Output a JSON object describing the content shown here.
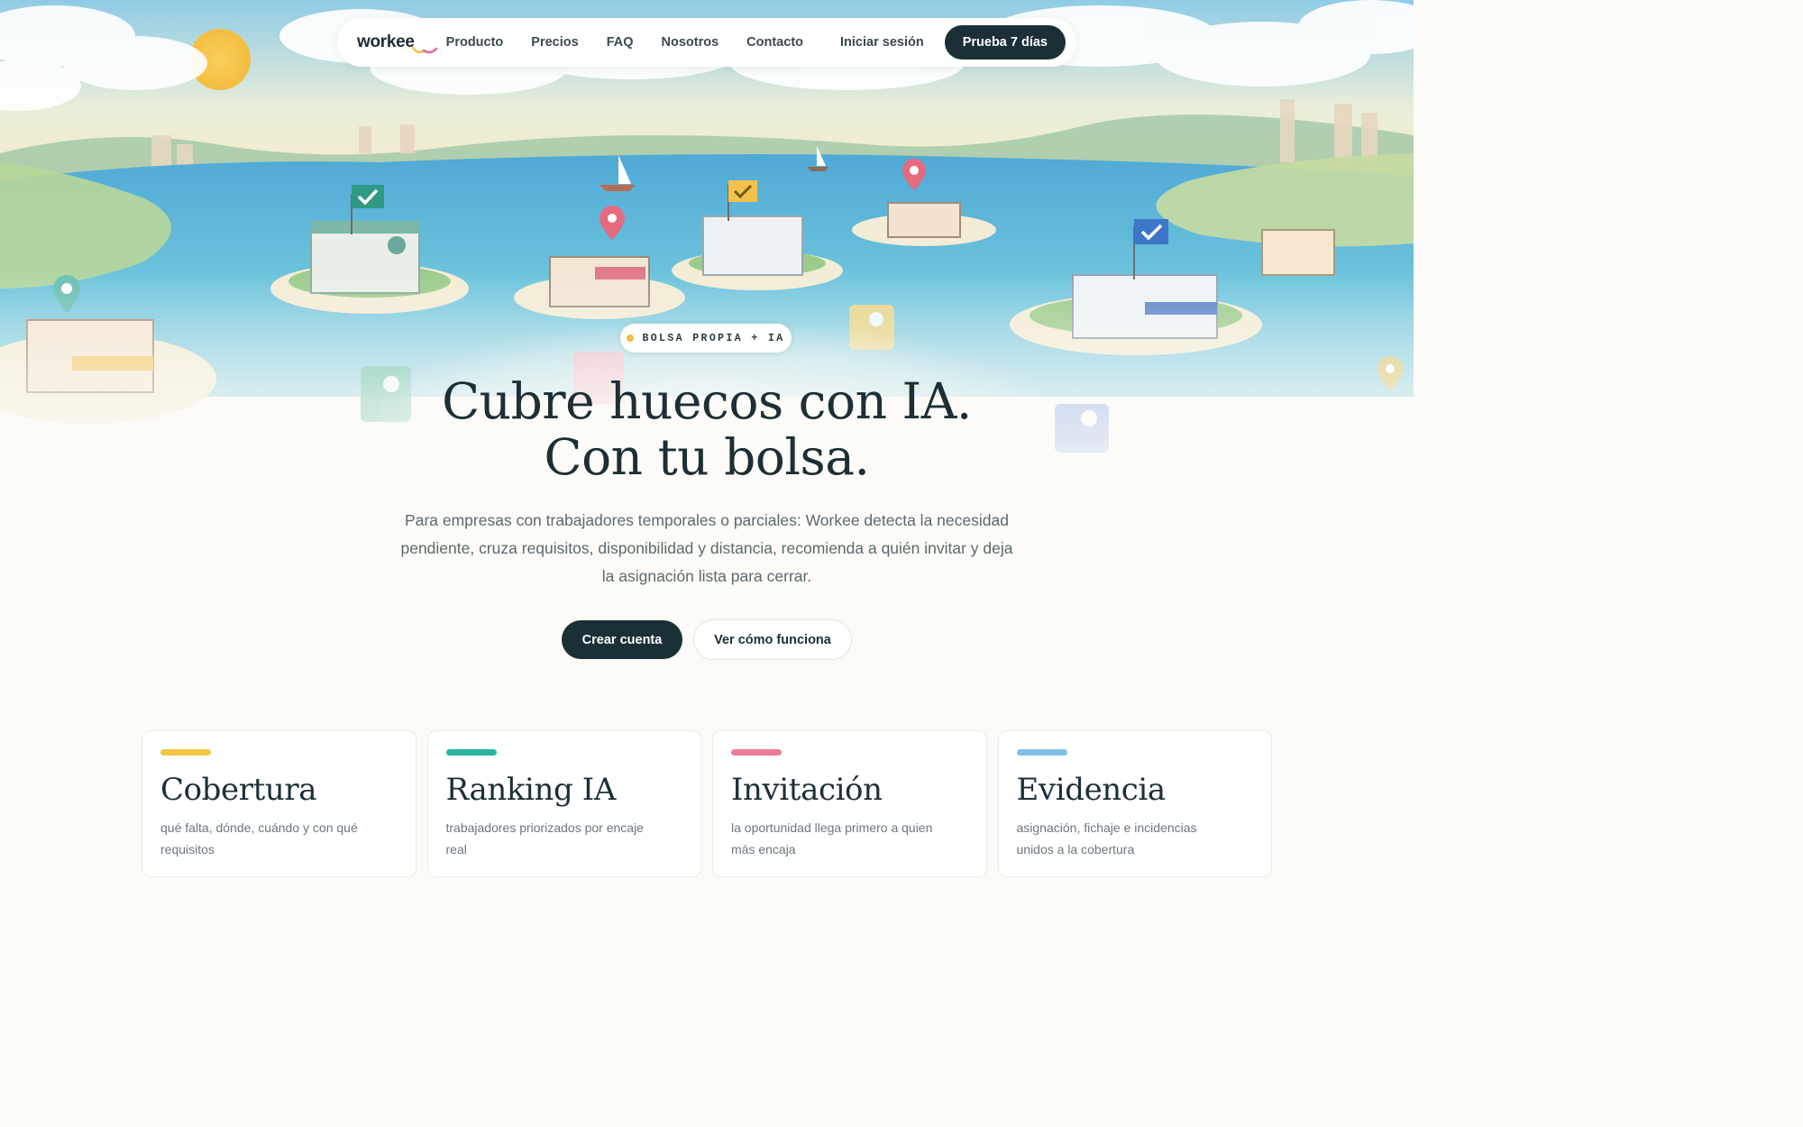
{
  "nav": {
    "logo": "workee",
    "links": [
      "Producto",
      "Precios",
      "FAQ",
      "Nosotros",
      "Contacto"
    ],
    "login": "Iniciar sesión",
    "cta": "Prueba 7 días"
  },
  "hero": {
    "badge": "BOLSA PROPIA + IA",
    "headline_line1": "Cubre huecos con IA.",
    "headline_line2": "Con tu bolsa.",
    "subtitle": "Para empresas con trabajadores temporales o parciales: Workee detecta la necesidad pendiente, cruza requisitos, disponibilidad y distancia, recomienda a quién invitar y deja la asignación lista para cerrar.",
    "primary_button": "Crear cuenta",
    "secondary_button": "Ver cómo funciona"
  },
  "features": [
    {
      "title": "Cobertura",
      "description": "qué falta, dónde, cuándo y con qué requisitos",
      "color": "#f2c646"
    },
    {
      "title": "Ranking IA",
      "description": "trabajadores priorizados por encaje real",
      "color": "#2bb3a2"
    },
    {
      "title": "Invitación",
      "description": "la oportunidad llega primero a quien más encaja",
      "color": "#ec7b94"
    },
    {
      "title": "Evidencia",
      "description": "asignación, fichaje e incidencias unidos a la cobertura",
      "color": "#7ec0e6"
    }
  ],
  "colors": {
    "primary_dark": "#1b2f37",
    "badge_dot": "#f2bd3b",
    "sea": "#6cc3dc",
    "sky": "#bfe2ef"
  }
}
